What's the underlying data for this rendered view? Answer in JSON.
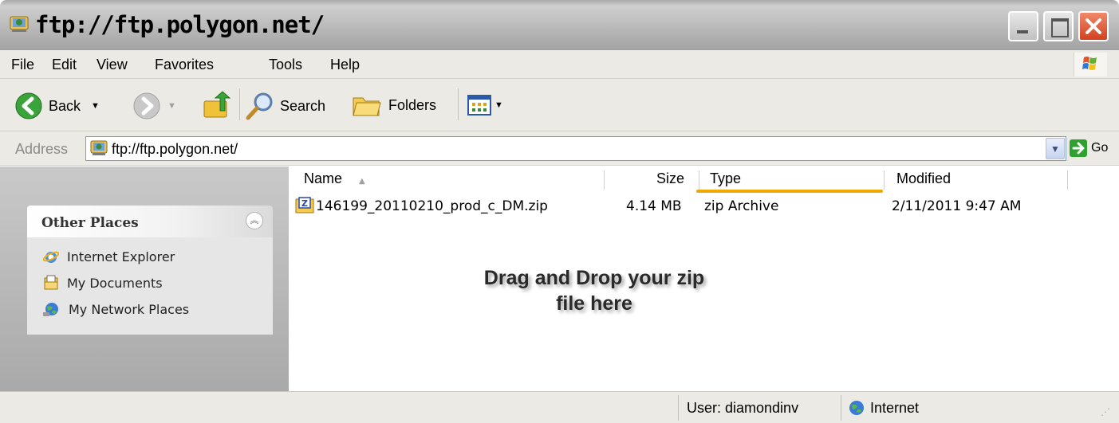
{
  "window": {
    "title": "ftp://ftp.polygon.net/"
  },
  "menu": {
    "items": [
      "File",
      "Edit",
      "View",
      "Favorites",
      "Tools",
      "Help"
    ]
  },
  "toolbar": {
    "back_label": "Back",
    "search_label": "Search",
    "folders_label": "Folders"
  },
  "address": {
    "label": "Address",
    "value": "ftp://ftp.polygon.net/",
    "go_label": "Go"
  },
  "sidebar": {
    "title": "Other Places",
    "items": [
      {
        "label": "Internet Explorer",
        "icon": "ie-icon"
      },
      {
        "label": "My Documents",
        "icon": "my-documents-icon"
      },
      {
        "label": "My Network Places",
        "icon": "network-places-icon"
      }
    ]
  },
  "file_list": {
    "columns": [
      "Name",
      "Size",
      "Type",
      "Modified"
    ],
    "rows": [
      {
        "name": "146199_20110210_prod_c_DM.zip",
        "size": "4.14 MB",
        "type": "zip Archive",
        "modified": "2/11/2011 9:47 AM"
      }
    ]
  },
  "overlay": {
    "line1": "Drag and Drop your zip",
    "line2": "file here"
  },
  "status": {
    "user": "User: diamondinv",
    "zone": "Internet"
  },
  "colors": {
    "accent_close": "#d2401e",
    "sort_highlight": "#f0a800",
    "go_green": "#2ea12e"
  }
}
